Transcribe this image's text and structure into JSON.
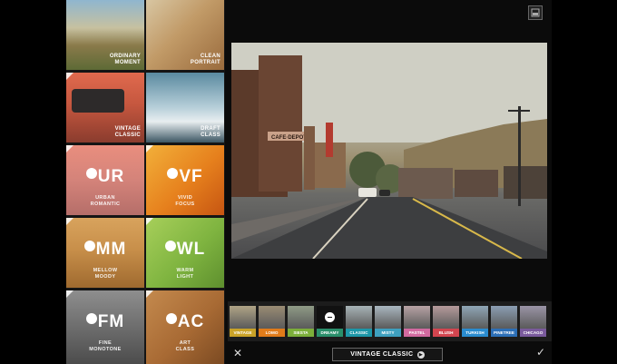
{
  "presets": [
    {
      "label": "ORDINARY\nMOMENT",
      "abbr": "",
      "sub": ""
    },
    {
      "label": "CLEAN\nPORTRAIT",
      "abbr": "",
      "sub": ""
    },
    {
      "label": "VINTAGE\nCLASSIC",
      "abbr": "",
      "sub": ""
    },
    {
      "label": "DRAFT\nCLASS",
      "abbr": "",
      "sub": ""
    },
    {
      "label": "",
      "abbr": "UR",
      "sub": "URBAN\nROMANTIC"
    },
    {
      "label": "",
      "abbr": "VF",
      "sub": "VIVID\nFOCUS"
    },
    {
      "label": "",
      "abbr": "MM",
      "sub": "MELLOW\nMOODY"
    },
    {
      "label": "",
      "abbr": "WL",
      "sub": "WARM\nLIGHT"
    },
    {
      "label": "",
      "abbr": "FM",
      "sub": "FINE\nMONOTONE"
    },
    {
      "label": "",
      "abbr": "AC",
      "sub": "ART\nCLASS"
    }
  ],
  "filters": [
    {
      "label": "VINTAGE",
      "color": "#c9a227"
    },
    {
      "label": "LOMO",
      "color": "#e07b1a"
    },
    {
      "label": "SIESTA",
      "color": "#7cae3a"
    },
    {
      "label": "DREAMY",
      "color": "#2a8f6b"
    },
    {
      "label": "CLASSIC",
      "color": "#1d97a8"
    },
    {
      "label": "MISTY",
      "color": "#3ea0bf"
    },
    {
      "label": "PASTEL",
      "color": "#d26aa0"
    },
    {
      "label": "BLUSH",
      "color": "#d2454f"
    },
    {
      "label": "TURKISH",
      "color": "#2a8ccf"
    },
    {
      "label": "PINETREE",
      "color": "#2c6fb7"
    },
    {
      "label": "CHICAGO",
      "color": "#7a5a9c"
    }
  ],
  "selected_filter": "DREAMY",
  "bottom": {
    "title": "VINTAGE CLASSIC",
    "close": "✕",
    "confirm": "✓"
  },
  "photo_sign": "CAFE·DEPOT"
}
